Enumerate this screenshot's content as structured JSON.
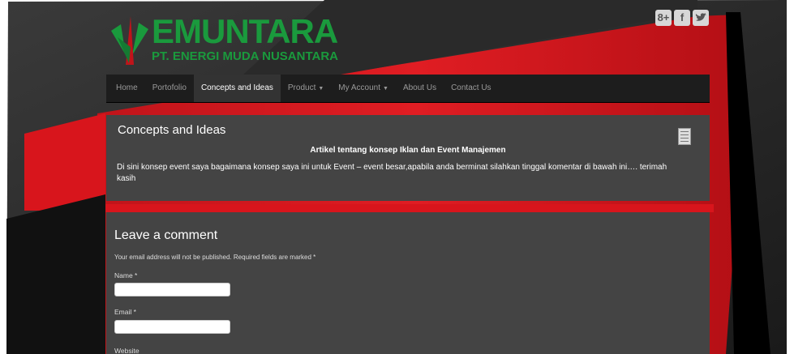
{
  "social": {
    "gplus": "8+",
    "facebook": "f",
    "twitter": "t"
  },
  "logo": {
    "name": "EMUNTARA",
    "subtitle": "PT. ENERGI MUDA NUSANTARA"
  },
  "nav": {
    "items": [
      {
        "label": "Home"
      },
      {
        "label": "Portofolio"
      },
      {
        "label": "Concepts and Ideas",
        "active": true
      },
      {
        "label": "Product",
        "dropdown": true
      },
      {
        "label": "My Account",
        "dropdown": true
      },
      {
        "label": "About Us"
      },
      {
        "label": "Contact Us"
      }
    ]
  },
  "post": {
    "title": "Concepts and Ideas",
    "heading": "Artikel tentang konsep Iklan dan Event Manajemen",
    "body": "Di sini konsep event saya bagaimana konsep saya ini untuk Event – event besar,apabila anda berminat silahkan tinggal komentar di bawah ini…. terimah kasih"
  },
  "comment": {
    "title": "Leave a comment",
    "note": "Your email address will not be published. Required fields are marked *",
    "name_label": "Name *",
    "email_label": "Email *",
    "website_label": "Website",
    "name_value": "",
    "email_value": ""
  },
  "colors": {
    "red": "#d8151c",
    "logo_green": "#1a9a3d",
    "panel": "#444444",
    "nav": "#1d1d1d"
  }
}
